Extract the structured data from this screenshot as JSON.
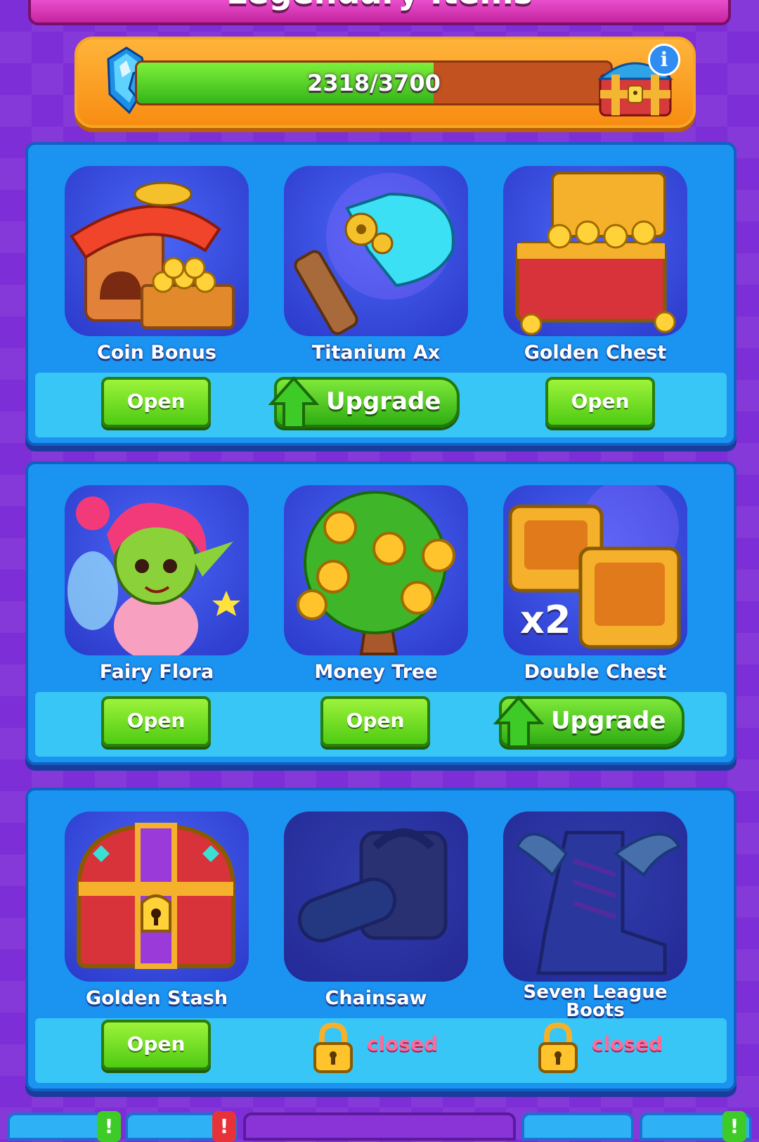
{
  "header": {
    "title": "Legendary Items"
  },
  "progress": {
    "text": "2318/3700",
    "current": 2318,
    "max": 3700
  },
  "panels": [
    {
      "items": [
        {
          "name": "Coin Bonus",
          "action": "Open",
          "icon": "coin-bonus-icon"
        },
        {
          "name": "Titanium Ax",
          "action": "Upgrade",
          "icon": "titanium-ax-icon"
        },
        {
          "name": "Golden Chest",
          "action": "Open",
          "icon": "golden-chest-icon"
        }
      ]
    },
    {
      "items": [
        {
          "name": "Fairy Flora",
          "action": "Open",
          "icon": "fairy-icon"
        },
        {
          "name": "Money Tree",
          "action": "Open",
          "icon": "money-tree-icon"
        },
        {
          "name": "Double Chest",
          "action": "Upgrade",
          "icon": "double-chest-icon",
          "badge": "x2"
        }
      ]
    },
    {
      "items": [
        {
          "name": "Golden Stash",
          "action": "Open",
          "icon": "golden-stash-icon"
        },
        {
          "name": "Chainsaw",
          "status": "closed",
          "icon": "chainsaw-icon"
        },
        {
          "name_line1": "Seven League",
          "name_line2": "Boots",
          "status": "closed",
          "icon": "boots-icon"
        }
      ]
    }
  ],
  "nav": {
    "alert": "!"
  },
  "colors": {
    "open": "#4fcb13",
    "closed": "#ff6b9a",
    "panel": "#1b93f0",
    "background": "#7d2ed6"
  }
}
